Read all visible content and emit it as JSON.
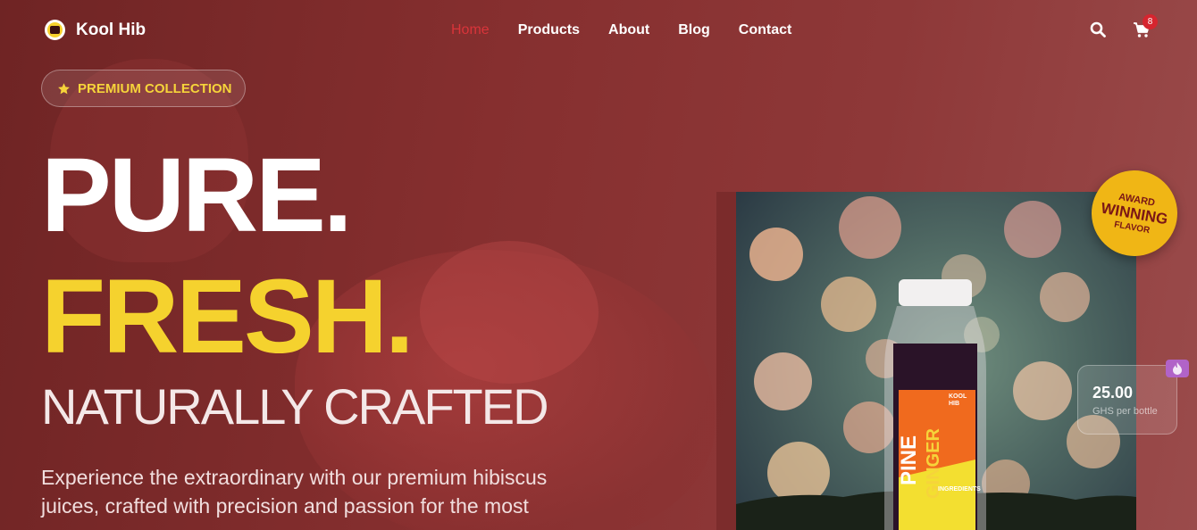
{
  "brand": {
    "name": "Kool Hib"
  },
  "nav": {
    "links": [
      {
        "label": "Home",
        "active": true
      },
      {
        "label": "Products"
      },
      {
        "label": "About"
      },
      {
        "label": "Blog"
      },
      {
        "label": "Contact"
      }
    ],
    "cart_count": "8",
    "icons": {
      "search": "search-icon",
      "cart": "cart-icon"
    }
  },
  "hero": {
    "badge": "PREMIUM COLLECTION",
    "line1": "PURE.",
    "line2": "FRESH.",
    "line3": "NATURALLY CRAFTED",
    "description": "Experience the extraordinary with our premium hibiscus juices, crafted with precision and passion for the most"
  },
  "product": {
    "bottle_label_1": "PINE",
    "bottle_label_2": "GINGER",
    "bottle_brand": "KOOL HIB",
    "bottle_ingredients": "INGREDIENTS"
  },
  "award": {
    "line1": "AWARD",
    "line2": "WINNING",
    "line3": "FLAVOR"
  },
  "price": {
    "value": "25.00",
    "unit": "GHS per bottle"
  },
  "colors": {
    "accent": "#f5d22e",
    "active_link": "#d9343a",
    "badge": "#d6252f"
  }
}
